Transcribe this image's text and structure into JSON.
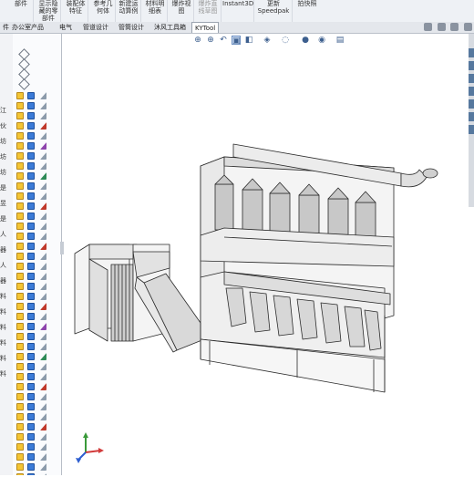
{
  "ribbon": {
    "items": [
      {
        "line1": "部件",
        "line2": ""
      },
      {
        "line1": "显示隐",
        "line2": "藏的零",
        "line3": "部件"
      },
      {
        "line1": "装配体",
        "line2": "特征"
      },
      {
        "line1": "参考几",
        "line2": "何体"
      },
      {
        "line1": "新建运",
        "line2": "动算例"
      },
      {
        "line1": "材料明",
        "line2": "细表"
      },
      {
        "line1": "爆炸视",
        "line2": "图"
      },
      {
        "line1": "爆炸直",
        "line2": "线草图"
      },
      {
        "line1": "Instant3D",
        "line2": ""
      },
      {
        "line1": "更新",
        "line2": "Speedpak"
      },
      {
        "line1": "拍快照",
        "line2": ""
      }
    ]
  },
  "tabs": [
    {
      "label": "件"
    },
    {
      "label": "办公室产品"
    },
    {
      "label": "电气"
    },
    {
      "label": "管道设计"
    },
    {
      "label": "管筒设计"
    },
    {
      "label": "沐风工具箱"
    },
    {
      "label": "KYTool",
      "active": true
    }
  ],
  "tree": {
    "side_labels": [
      "江",
      "伙",
      "坊",
      "坊",
      "坊",
      "是",
      "昱",
      "是",
      "人",
      "器",
      "人",
      "器",
      "料",
      "料",
      "料",
      "料",
      "料",
      "料"
    ]
  },
  "colors": {
    "ribbon_bg": "#eef1f5",
    "tree_bg": "#fafbfd",
    "model_fill": "#f4f4f4",
    "model_stroke": "#2a2a2a",
    "cyclone_shade": "#b8b8b8"
  },
  "view_icons": [
    "zoom-fit-icon",
    "zoom-area-icon",
    "previous-view-icon",
    "section-view-icon",
    "view-orientation-icon",
    "display-style-icon",
    "hide-show-icon",
    "edit-appearance-icon",
    "apply-scene-icon",
    "view-settings-icon"
  ]
}
